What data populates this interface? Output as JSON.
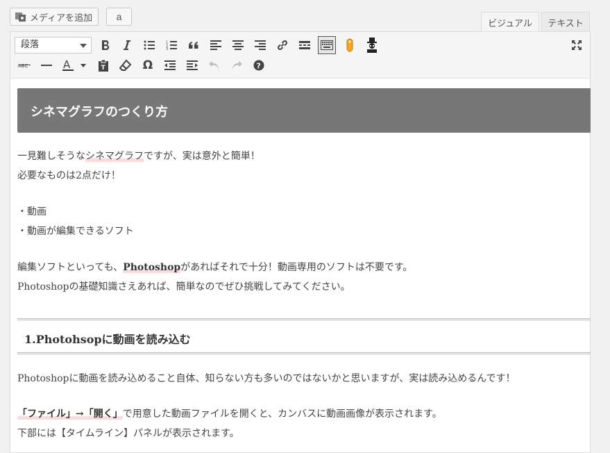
{
  "topbar": {
    "media_button": "メディアを追加",
    "amazon_button": "a"
  },
  "tabs": {
    "visual": "ビジュアル",
    "text": "テキスト"
  },
  "toolbar": {
    "format_select": "段落"
  },
  "content": {
    "heading1": "シネマグラフのつくり方",
    "p1_pre": "一見難しそうな",
    "p1_hl": "シネマグラフ",
    "p1_post": "ですが、実は意外と簡単！",
    "p2": "必要なものは2点だけ！",
    "item1": "・動画",
    "item2": "・動画が編集できるソフト",
    "p3_pre": "編集ソフトといっても、",
    "p3_bold": "Photoshop",
    "p3_post": "があればそれで十分！動画専用のソフトは不要です。",
    "p4": "Photoshopの基礎知識さえあれば、簡単なのでぜひ挑戦してみてください。",
    "heading2": "1.Photohsopに動画を読み込む",
    "p5": "Photoshopに動画を読み込めること自体、知らない方も多いのではないかと思いますが、実は読み込めるんです！",
    "p6_hl": "「ファイル」→「開く」",
    "p6_post": "で用意した動画ファイルを開くと、カンバスに動画画像が表示されます。",
    "p7": "下部には【タイムライン】パネルが表示されます。"
  }
}
